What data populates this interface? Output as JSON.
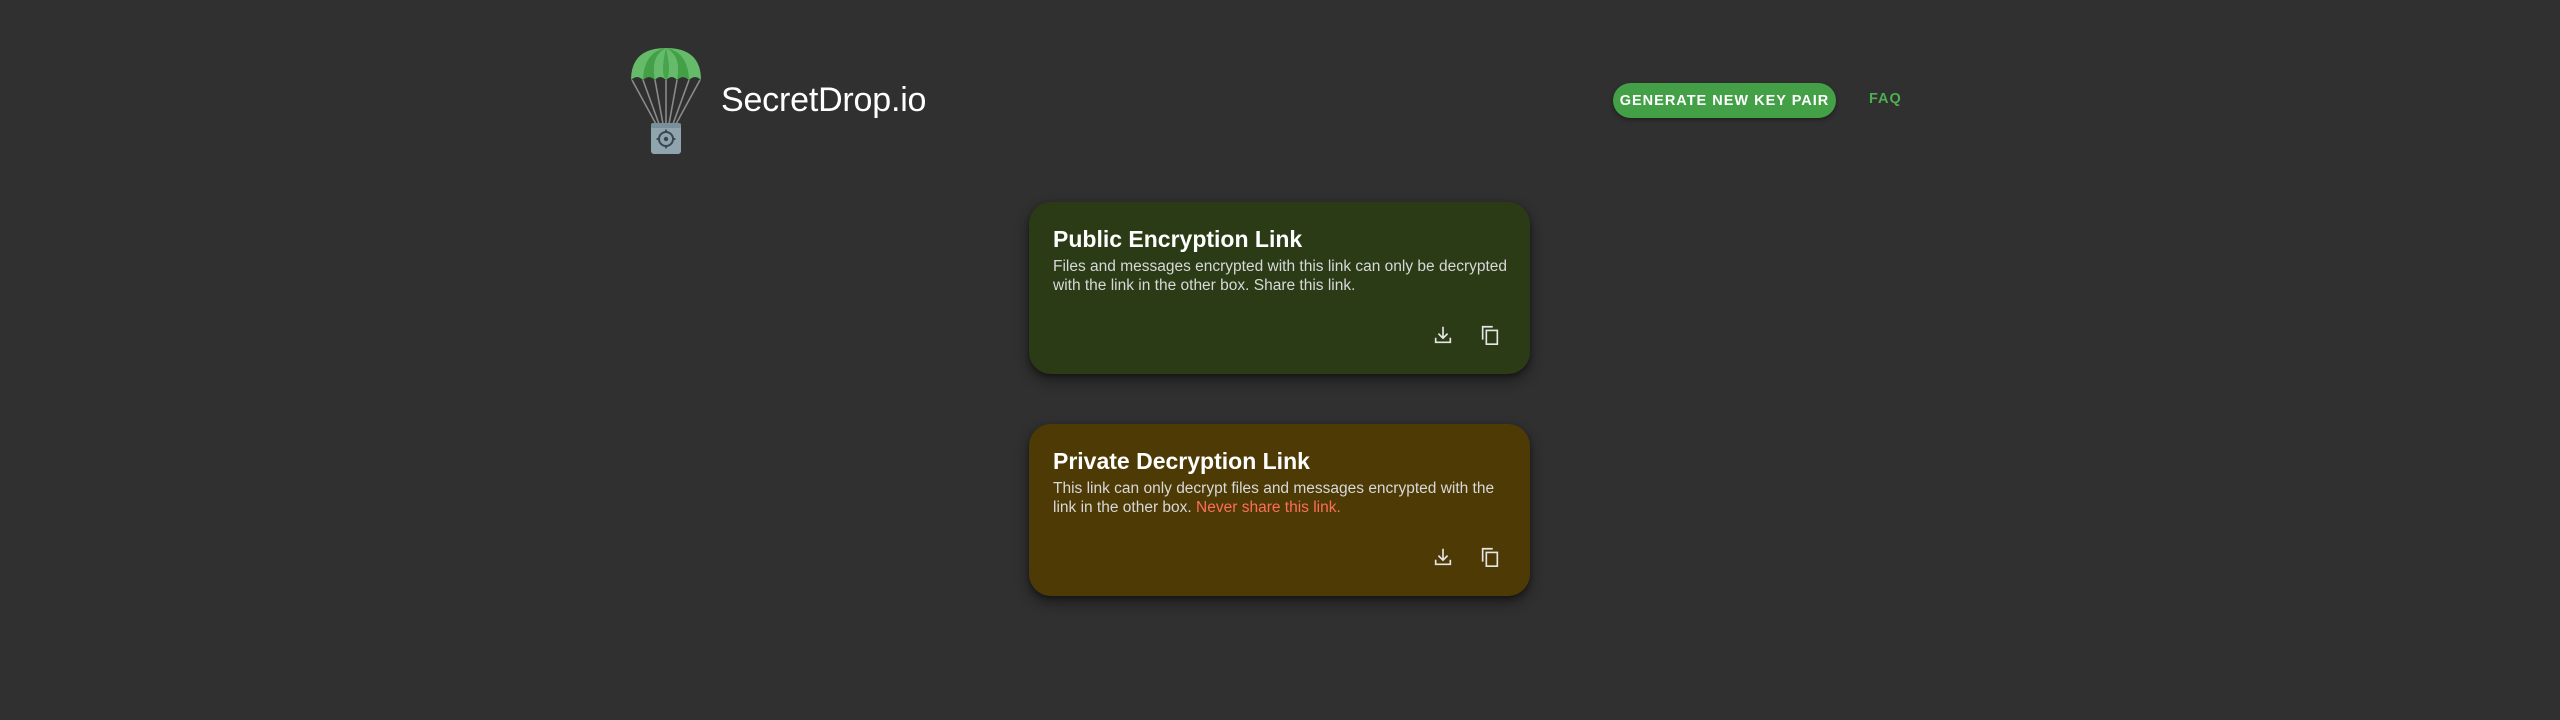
{
  "header": {
    "brand": "SecretDrop.io",
    "generate_button": "GENERATE NEW KEY PAIR",
    "faq_link": "FAQ"
  },
  "public_card": {
    "title": "Public Encryption Link",
    "description": "Files and messages encrypted with this link can only be decrypted with the link in the other box. Share this link.",
    "download_icon": "download-icon",
    "copy_icon": "copy-icon"
  },
  "private_card": {
    "title": "Private Decryption Link",
    "description": "This link can only decrypt files and messages encrypted with the link in the other box.",
    "warning": "Never share this link.",
    "download_icon": "download-icon",
    "copy_icon": "copy-icon"
  },
  "colors": {
    "background": "#303030",
    "accent": "#43a047",
    "public_card": "#2a3b16",
    "private_card": "#4d3a05",
    "warning": "#ff6e5a"
  }
}
